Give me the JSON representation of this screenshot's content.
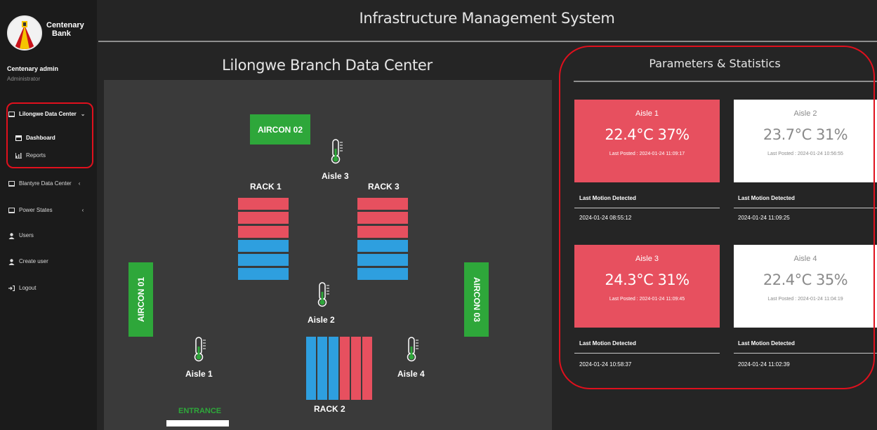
{
  "header": {
    "app_title": "Infrastructure Management System"
  },
  "sidebar": {
    "logo_text_line1": "Centenary",
    "logo_text_line2": "Bank",
    "user_name": "Centenary admin",
    "user_role": "Administrator",
    "items": [
      {
        "label": "Lilongwe Data Center",
        "icon": "monitor-icon",
        "expanded": true
      },
      {
        "label": "Dashboard",
        "icon": "calendar-icon"
      },
      {
        "label": "Reports",
        "icon": "bar-chart-icon"
      },
      {
        "label": "Blantyre Data Center",
        "icon": "monitor-icon",
        "expanded": false
      },
      {
        "label": "Power States",
        "icon": "monitor-icon",
        "expanded": false
      },
      {
        "label": "Users",
        "icon": "user-icon"
      },
      {
        "label": "Create user",
        "icon": "user-icon"
      },
      {
        "label": "Logout",
        "icon": "logout-icon"
      }
    ],
    "expanded_chevron": "⌄",
    "collapsed_chevron": "‹"
  },
  "floor": {
    "title": "Lilongwe Branch Data Center",
    "aircons": [
      "AIRCON 02",
      "AIRCON 01",
      "AIRCON 03"
    ],
    "racks": [
      "RACK 1",
      "RACK 3",
      "RACK 2"
    ],
    "aisles": [
      "Aisle 3",
      "Aisle 2",
      "Aisle 1",
      "Aisle 4"
    ],
    "entrance": "ENTRANCE"
  },
  "stats": {
    "title": "Parameters & Statistics",
    "motion_label": "Last Motion Detected",
    "cards": [
      {
        "name": "Aisle 1",
        "reading": "22.4°C 37%",
        "posted": "Last Posted : 2024-01-24 11:09:17",
        "status": "alert",
        "motion": "2024-01-24 08:55:12"
      },
      {
        "name": "Aisle 2",
        "reading": "23.7°C 31%",
        "posted": "Last Posted : 2024-01-24 10:56:55",
        "status": "normal",
        "motion": "2024-01-24 11:09:25"
      },
      {
        "name": "Aisle 3",
        "reading": "24.3°C 31%",
        "posted": "Last Posted : 2024-01-24 11:09:45",
        "status": "alert",
        "motion": "2024-01-24 10:58:37"
      },
      {
        "name": "Aisle 4",
        "reading": "22.4°C 35%",
        "posted": "Last Posted : 2024-01-24 11:04:19",
        "status": "normal",
        "motion": "2024-01-24 11:02:39"
      }
    ]
  },
  "colors": {
    "alert": "#e7505f",
    "cool": "#2e9fdf",
    "aircon": "#2ea73a",
    "highlight": "#e0101d"
  }
}
